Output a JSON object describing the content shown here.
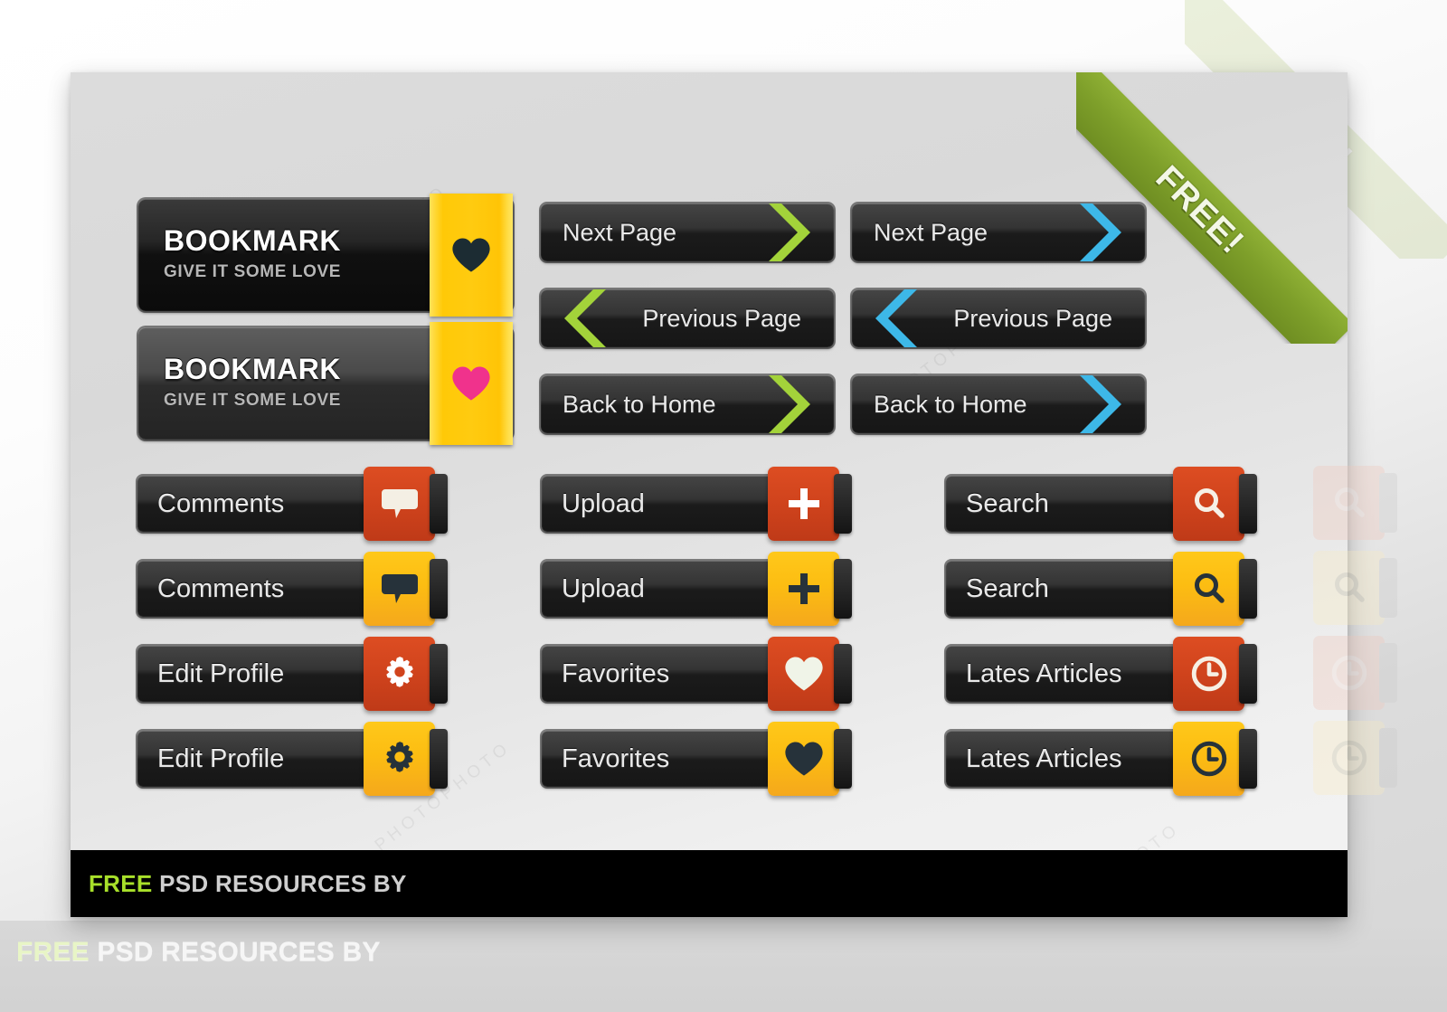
{
  "outer_caption": {
    "free": "FREE",
    "rest": "PSD RESOURCES BY"
  },
  "ribbon": {
    "label": "FREE!",
    "color": "#7e9f2a"
  },
  "footer": {
    "free": "FREE",
    "rest": "PSD RESOURCES BY",
    "free_color": "#a8e02a",
    "bg": "#000000"
  },
  "bookmark_buttons": [
    {
      "title": "BOOKMARK",
      "subtitle": "GIVE IT SOME LOVE",
      "state": "dark",
      "icon": "heart-icon",
      "icon_color": "#1c2c33",
      "ribbon_color": "#ffc907"
    },
    {
      "title": "BOOKMARK",
      "subtitle": "GIVE IT SOME LOVE",
      "state": "light",
      "icon": "heart-icon",
      "icon_color": "#f0328c",
      "ribbon_color": "#ffc907"
    }
  ],
  "nav_buttons": [
    {
      "label": "Next Page",
      "direction": "right",
      "accent": "green",
      "accent_color": "#a3d33a"
    },
    {
      "label": "Next Page",
      "direction": "right",
      "accent": "blue",
      "accent_color": "#3db8e8"
    },
    {
      "label": "Previous Page",
      "direction": "left",
      "accent": "green",
      "accent_color": "#a3d33a"
    },
    {
      "label": "Previous Page",
      "direction": "left",
      "accent": "blue",
      "accent_color": "#3db8e8"
    },
    {
      "label": "Back to Home",
      "direction": "right",
      "accent": "green",
      "accent_color": "#a3d33a"
    },
    {
      "label": "Back to Home",
      "direction": "right",
      "accent": "blue",
      "accent_color": "#3db8e8"
    }
  ],
  "icon_buttons": [
    {
      "label": "Comments",
      "icon": "speech-bubble-icon",
      "tab": "red",
      "tab_color": "#d1441d",
      "glyph_color": "#f4efe4"
    },
    {
      "label": "Comments",
      "icon": "speech-bubble-icon",
      "tab": "yellow",
      "tab_color": "#fcbd12",
      "glyph_color": "#26323a"
    },
    {
      "label": "Edit Profile",
      "icon": "gear-icon",
      "tab": "red",
      "tab_color": "#d1441d",
      "glyph_color": "#ffffff"
    },
    {
      "label": "Edit Profile",
      "icon": "gear-icon",
      "tab": "yellow",
      "tab_color": "#fcbd12",
      "glyph_color": "#26323a"
    },
    {
      "label": "Upload",
      "icon": "plus-icon",
      "tab": "red",
      "tab_color": "#d1441d",
      "glyph_color": "#ffffff"
    },
    {
      "label": "Upload",
      "icon": "plus-icon",
      "tab": "yellow",
      "tab_color": "#fcbd12",
      "glyph_color": "#26323a"
    },
    {
      "label": "Favorites",
      "icon": "heart-icon",
      "tab": "red",
      "tab_color": "#d1441d",
      "glyph_color": "#f0f4e8"
    },
    {
      "label": "Favorites",
      "icon": "heart-icon",
      "tab": "yellow",
      "tab_color": "#fcbd12",
      "glyph_color": "#26323a"
    },
    {
      "label": "Search",
      "icon": "magnifier-icon",
      "tab": "red",
      "tab_color": "#d1441d",
      "glyph_color": "#f6f0e6"
    },
    {
      "label": "Search",
      "icon": "magnifier-icon",
      "tab": "yellow",
      "tab_color": "#fcbd12",
      "glyph_color": "#26323a"
    },
    {
      "label": "Lates Articles",
      "icon": "clock-icon",
      "tab": "red",
      "tab_color": "#d1441d",
      "glyph_color": "#f6efe4"
    },
    {
      "label": "Lates Articles",
      "icon": "clock-icon",
      "tab": "yellow",
      "tab_color": "#fcbd12",
      "glyph_color": "#26323a"
    }
  ],
  "watermarks": {
    "a": "PHOTOPHOTO",
    "b": "PHOTOPHOTO",
    "c": "PHOTOPHOTO"
  }
}
